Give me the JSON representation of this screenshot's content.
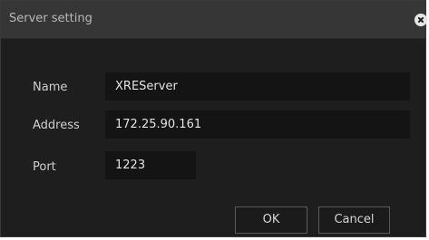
{
  "dialog": {
    "title": "Server setting"
  },
  "fields": {
    "name": {
      "label": "Name",
      "value": "XREServer"
    },
    "address": {
      "label": "Address",
      "value": "172.25.90.161"
    },
    "port": {
      "label": "Port",
      "value": "1223"
    }
  },
  "buttons": {
    "ok": "OK",
    "cancel": "Cancel"
  },
  "icons": {
    "close": "close-icon"
  },
  "colors": {
    "background": "#1e1e1e",
    "titlebar": "#363636",
    "input": "#141414"
  }
}
